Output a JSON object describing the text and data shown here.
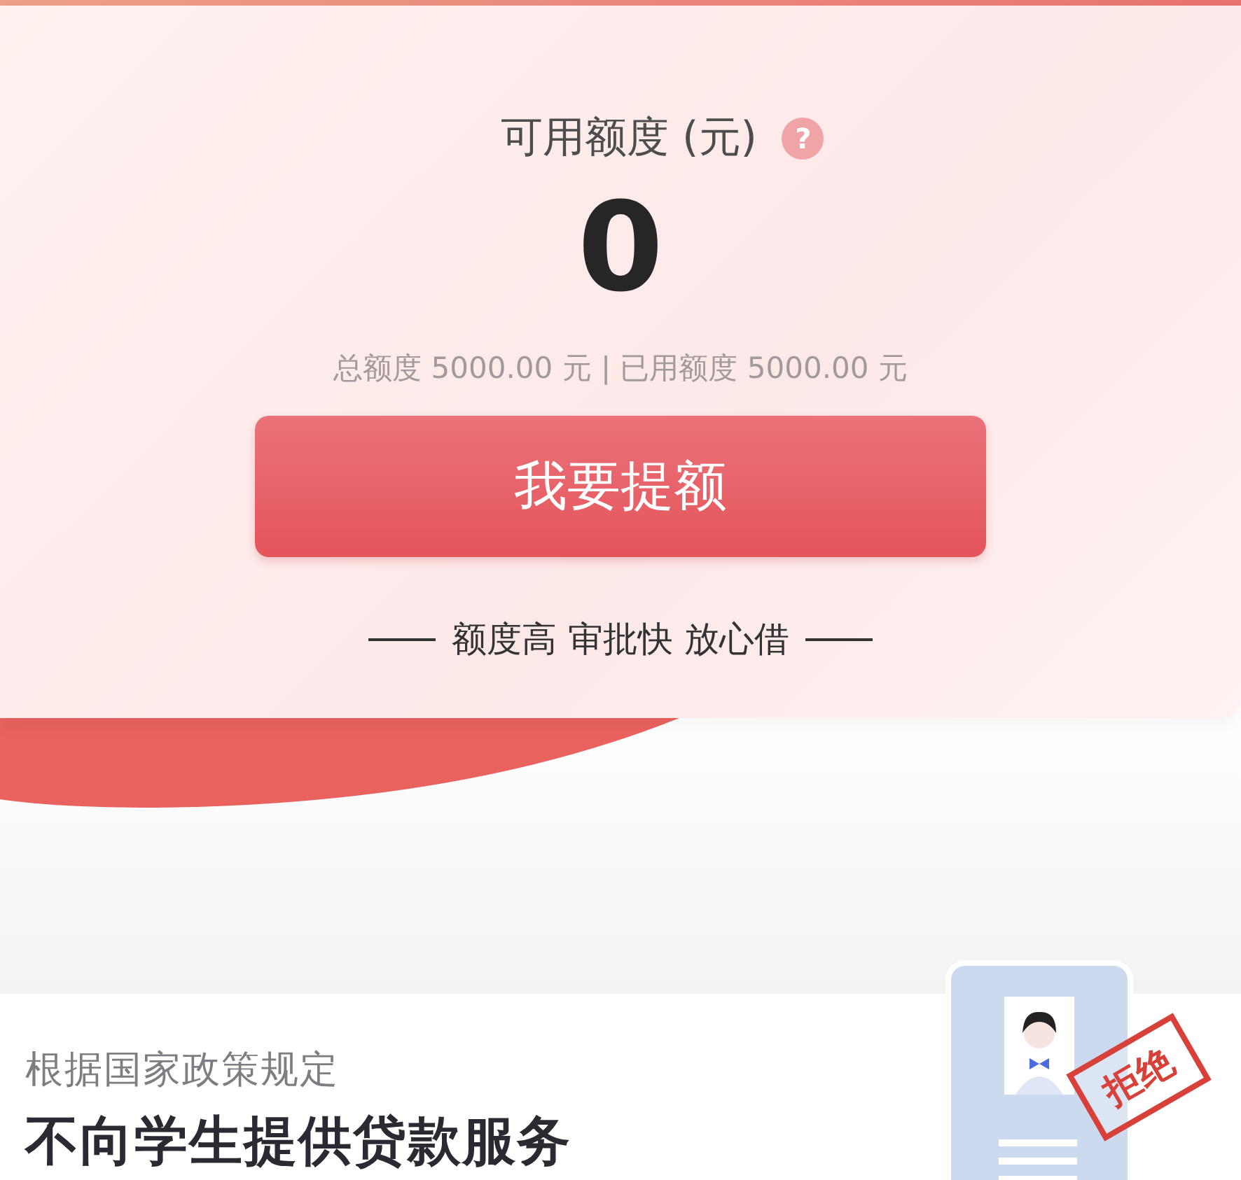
{
  "credit": {
    "label": "可用额度 (元)",
    "help_icon": "?",
    "available": "0",
    "summary": "总额度 5000.00 元 | 已用额度 5000.00 元"
  },
  "raise_button": {
    "label": "我要提额"
  },
  "slogan": "额度高 审批快 放心借",
  "notice": {
    "subtitle": "根据国家政策规定",
    "title": "不向学生提供贷款服务",
    "stamp": "拒绝"
  }
}
